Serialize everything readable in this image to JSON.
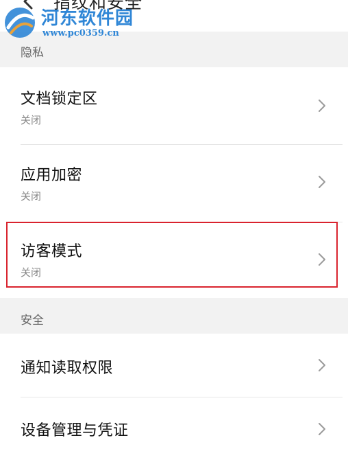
{
  "header": {
    "title": "指纹和安全"
  },
  "watermark": {
    "name": "河东软件园",
    "url": "www.pc0359.cn"
  },
  "sections": {
    "privacy": {
      "label": "隐私",
      "items": [
        {
          "title": "文档锁定区",
          "status": "关闭"
        },
        {
          "title": "应用加密",
          "status": "关闭"
        },
        {
          "title": "访客模式",
          "status": "关闭"
        }
      ]
    },
    "security": {
      "label": "安全",
      "items": [
        {
          "title": "通知读取权限"
        },
        {
          "title": "设备管理与凭证"
        }
      ]
    }
  },
  "colors": {
    "background": "#f2f2f2",
    "card": "#ffffff",
    "highlight": "#d9232e",
    "watermark": "#2f86d6",
    "chevron": "#9a9a9a"
  },
  "icons": {
    "back": "chevron-left-icon",
    "row_arrow": "chevron-right-icon",
    "watermark_logo": "logo-icon"
  }
}
